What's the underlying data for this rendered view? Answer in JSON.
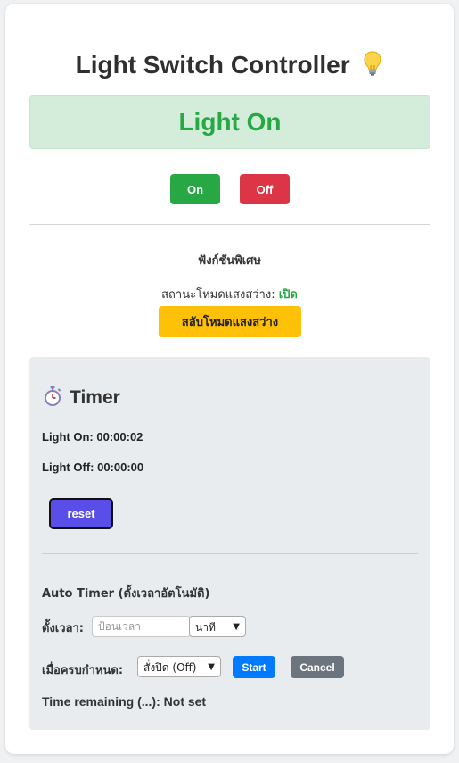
{
  "header": {
    "title": "Light Switch Controller",
    "status_text": "Light On"
  },
  "controls": {
    "on_label": "On",
    "off_label": "Off"
  },
  "special": {
    "title": "ฟังก์ชันพิเศษ",
    "mode_label": "สถานะโหมดแสงสว่าง: ",
    "mode_value": "เปิด",
    "toggle_label": "สลับโหมดแสงสว่าง"
  },
  "timer": {
    "heading": "Timer",
    "on_label": "Light On: ",
    "on_value": "00:00:02",
    "off_label": "Light Off: ",
    "off_value": "00:00:00",
    "reset_label": "reset"
  },
  "auto_timer": {
    "title": "Auto Timer (ตั้งเวลาอัตโนมัติ)",
    "set_time_label": "ตั้งเวลา:",
    "time_placeholder": "ป้อนเวลา",
    "unit_selected": "นาที",
    "when_label": "เมื่อครบกำหนด:",
    "action_selected": "สั่งปิด (Off)",
    "start_label": "Start",
    "cancel_label": "Cancel",
    "remaining_text": "Time remaining (...): Not set"
  },
  "colors": {
    "success": "#28a745",
    "danger": "#dc3545",
    "warning": "#ffc107",
    "primary": "#007bff",
    "secondary": "#6c757d",
    "reset": "#5a4ee8"
  },
  "icons": {
    "title_icon": "lightbulb-icon",
    "timer_icon": "stopwatch-icon"
  }
}
